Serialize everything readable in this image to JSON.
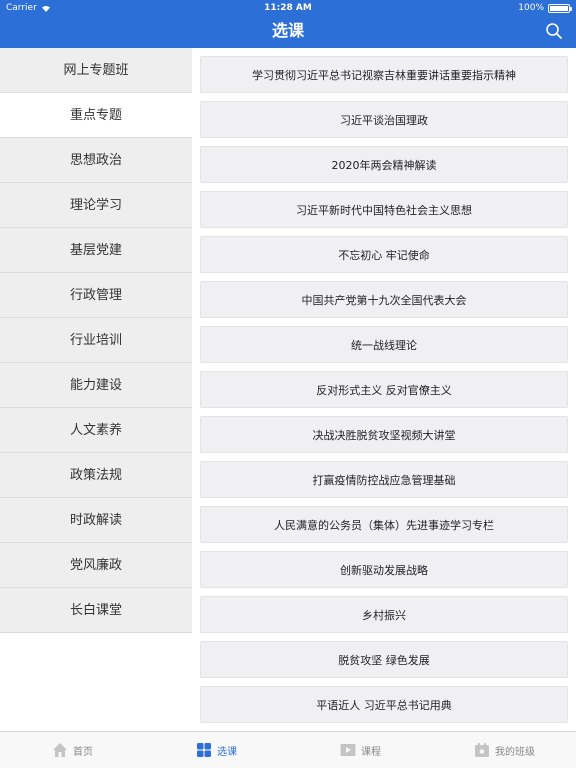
{
  "status_bar": {
    "carrier": "Carrier",
    "time": "11:28 AM",
    "battery": "100%",
    "battery_level": 1.0
  },
  "header": {
    "title": "选课",
    "search_icon": "search-icon"
  },
  "sidebar": {
    "items": [
      {
        "label": "网上专题班",
        "active": false
      },
      {
        "label": "重点专题",
        "active": true
      },
      {
        "label": "思想政治",
        "active": false
      },
      {
        "label": "理论学习",
        "active": false
      },
      {
        "label": "基层党建",
        "active": false
      },
      {
        "label": "行政管理",
        "active": false
      },
      {
        "label": "行业培训",
        "active": false
      },
      {
        "label": "能力建设",
        "active": false
      },
      {
        "label": "人文素养",
        "active": false
      },
      {
        "label": "政策法规",
        "active": false
      },
      {
        "label": "时政解读",
        "active": false
      },
      {
        "label": "党风廉政",
        "active": false
      },
      {
        "label": "长白课堂",
        "active": false
      }
    ]
  },
  "topics": [
    "学习贯彻习近平总书记视察吉林重要讲话重要指示精神",
    "习近平谈治国理政",
    "2020年两会精神解读",
    "习近平新时代中国特色社会主义思想",
    "不忘初心 牢记使命",
    "中国共产党第十九次全国代表大会",
    "统一战线理论",
    "反对形式主义 反对官僚主义",
    "决战决胜脱贫攻坚视频大讲堂",
    "打赢疫情防控战应急管理基础",
    "人民满意的公务员（集体）先进事迹学习专栏",
    "创新驱动发展战略",
    "乡村振兴",
    "脱贫攻坚 绿色发展",
    "平语近人 习近平总书记用典"
  ],
  "tabbar": {
    "tabs": [
      {
        "label": "首页",
        "icon": "home-icon",
        "active": false
      },
      {
        "label": "选课",
        "icon": "grid-icon",
        "active": true
      },
      {
        "label": "课程",
        "icon": "play-icon",
        "active": false
      },
      {
        "label": "我的班级",
        "icon": "class-icon",
        "active": false
      }
    ]
  },
  "colors": {
    "accent": "#2c6fd6",
    "sidebar_bg": "#eeeeee",
    "topic_bg": "#f0f0f3",
    "tab_inactive": "#888888"
  }
}
